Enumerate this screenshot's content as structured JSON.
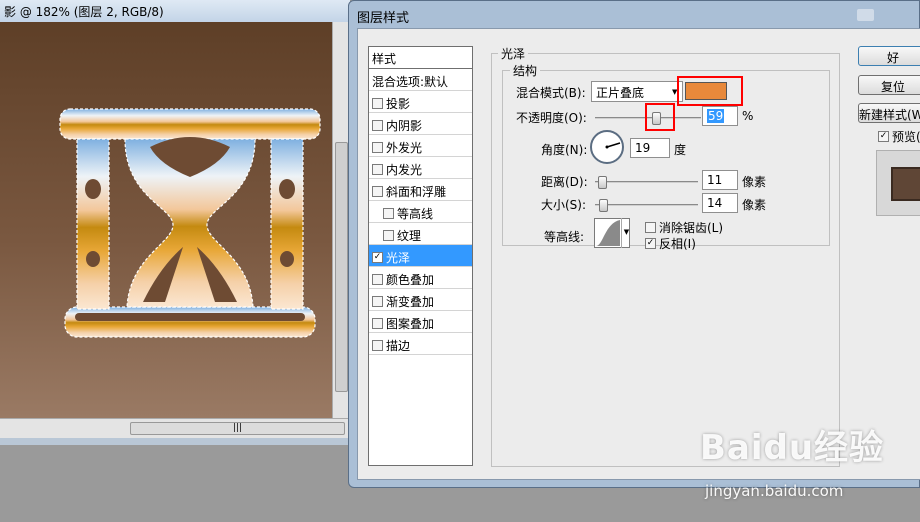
{
  "document": {
    "title": "影 @ 182% (图层 2, RGB/8)"
  },
  "dialog": {
    "title": "图层样式",
    "styles_header": "样式",
    "styles": [
      {
        "label": "混合选项:默认",
        "checkbox": false,
        "checked": false,
        "selected": false,
        "sub": false
      },
      {
        "label": "投影",
        "checkbox": true,
        "checked": false,
        "selected": false,
        "sub": false
      },
      {
        "label": "内阴影",
        "checkbox": true,
        "checked": false,
        "selected": false,
        "sub": false
      },
      {
        "label": "外发光",
        "checkbox": true,
        "checked": false,
        "selected": false,
        "sub": false
      },
      {
        "label": "内发光",
        "checkbox": true,
        "checked": false,
        "selected": false,
        "sub": false
      },
      {
        "label": "斜面和浮雕",
        "checkbox": true,
        "checked": false,
        "selected": false,
        "sub": false
      },
      {
        "label": "等高线",
        "checkbox": true,
        "checked": false,
        "selected": false,
        "sub": true
      },
      {
        "label": "纹理",
        "checkbox": true,
        "checked": false,
        "selected": false,
        "sub": true
      },
      {
        "label": "光泽",
        "checkbox": true,
        "checked": true,
        "selected": true,
        "sub": false
      },
      {
        "label": "颜色叠加",
        "checkbox": true,
        "checked": false,
        "selected": false,
        "sub": false
      },
      {
        "label": "渐变叠加",
        "checkbox": true,
        "checked": false,
        "selected": false,
        "sub": false
      },
      {
        "label": "图案叠加",
        "checkbox": true,
        "checked": false,
        "selected": false,
        "sub": false
      },
      {
        "label": "描边",
        "checkbox": true,
        "checked": false,
        "selected": false,
        "sub": false
      }
    ],
    "gloss": {
      "group_title": "光泽",
      "structure_title": "结构",
      "blend_mode_label": "混合模式(B):",
      "blend_mode_value": "正片叠底",
      "swatch_color": "#e8893b",
      "opacity_label": "不透明度(O):",
      "opacity_value": "59",
      "opacity_unit": "%",
      "angle_label": "角度(N):",
      "angle_value": "19",
      "angle_unit": "度",
      "distance_label": "距离(D):",
      "distance_value": "11",
      "distance_unit": "像素",
      "size_label": "大小(S):",
      "size_value": "14",
      "size_unit": "像素",
      "contour_label": "等高线:",
      "antialias_label": "消除锯齿(L)",
      "antialias_checked": false,
      "invert_label": "反相(I)",
      "invert_checked": true
    },
    "buttons": {
      "ok": "好",
      "reset": "复位",
      "new_style": "新建样式(W)..."
    },
    "preview_label": "预览(",
    "preview_checked": true
  },
  "watermark": {
    "brand": "Baidu经验",
    "url": "jingyan.baidu.com"
  }
}
